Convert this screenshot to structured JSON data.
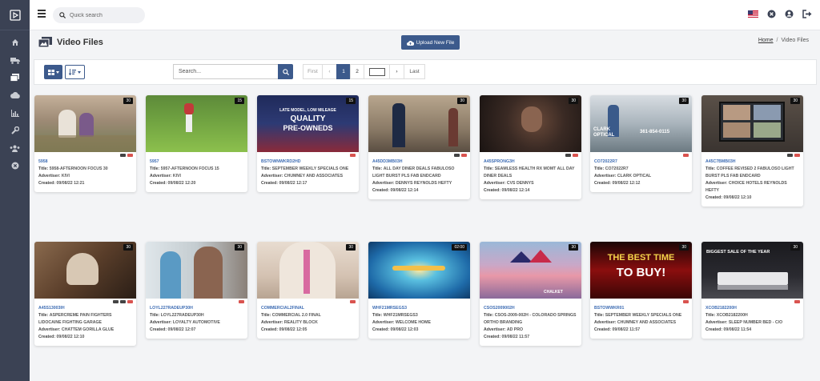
{
  "topbar": {
    "search_placeholder": "Quick search"
  },
  "header": {
    "title": "Video Files",
    "upload_label": "Upload New File",
    "breadcrumb_home": "Home",
    "breadcrumb_sep": "/",
    "breadcrumb_current": "Video Files"
  },
  "toolbar": {
    "search_placeholder": "Search...",
    "pager": {
      "first": "First",
      "prev": "‹",
      "page1": "1",
      "page2": "2",
      "next": "›",
      "last": "Last"
    }
  },
  "labels": {
    "title": "Title:",
    "advertiser": "Advertiser:",
    "created": "Created:"
  },
  "cards": [
    {
      "code": "5958",
      "title": "5958-AFTERNOON FOCUS 30",
      "advertiser": "KIVI",
      "created": "09/08/22 12:21",
      "duration": "30"
    },
    {
      "code": "5957",
      "title": "5957-AFTERNOON FOCUS 15",
      "advertiser": "KIVI",
      "created": "09/08/22 12:20",
      "duration": "15"
    },
    {
      "code": "BSTOWNWKRD2HD",
      "title": "SEPTEMBER WEEKLY SPECIALS ONE",
      "advertiser": "CHUMNEY AND ASSOCIATES",
      "created": "09/08/22 12:17",
      "duration": "15"
    },
    {
      "code": "A45DD3MB03H",
      "title": "ALL DAY DINER DEALS FABULOSO LIGHT BURST PLS FAB ENDCARD",
      "advertiser": "DENNYS REYNOLDS HEFTY",
      "created": "09/08/22 12:14",
      "duration": "30"
    },
    {
      "code": "A45SPRONG3H",
      "title": "SEAMLESS HEALTH RX MOMT ALL DAY DINER DEALS",
      "advertiser": "CVS DENNYS",
      "created": "09/08/22 12:14",
      "duration": "30"
    },
    {
      "code": "CO72022R7",
      "title": "CO72022R7",
      "advertiser": "CLARK OPTICAL",
      "created": "09/08/22 12:12",
      "duration": "30"
    },
    {
      "code": "A45C7BMB03H",
      "title": "COFFEE REVISED 2 FABULOSO LIGHT BURST PLS FAB ENDCARD",
      "advertiser": "CHOICE HOTELS REYNOLDS HEFTY",
      "created": "09/08/22 12:10",
      "duration": "30"
    },
    {
      "code": "A45S13003IH",
      "title": "ASPERCREME PAIN FIGHTERS LIDOCAINE FIGHTING GARAGE",
      "advertiser": "CHATTEM GORILLA GLUE",
      "created": "09/08/22 12:10",
      "duration": "30"
    },
    {
      "code": "LOYL227RADEUP30H",
      "title": "LOYL227RADEUP30H",
      "advertiser": "LOYALTY AUTOMOTIVE",
      "created": "09/08/22 12:07",
      "duration": "30"
    },
    {
      "code": "COMMERCIAL2FINAL",
      "title": "COMMERCIAL 2.0 FINAL",
      "advertiser": "REALITY BLOCK",
      "created": "09/08/22 12:05",
      "duration": "30"
    },
    {
      "code": "WHF21MRSEGS3",
      "title": "WHF21MRSEGS3",
      "advertiser": "WELCOME HOME",
      "created": "09/08/22 12:03",
      "duration": "02:00"
    },
    {
      "code": "CSOS2009002H",
      "title": "CSOS-2009-002H - COLORADO SPRINGS ORTHO BRANDING",
      "advertiser": "AD PRO",
      "created": "09/08/22 11:57",
      "duration": "30"
    },
    {
      "code": "BSTOWWKR01",
      "title": "SEPTEMBER WEEKLY SPECIALS ONE",
      "advertiser": "CHUMNEY AND ASSOCIATES",
      "created": "09/08/22 11:57",
      "duration": "30"
    },
    {
      "code": "XCOB2182200H",
      "title": "XCOB2182200H",
      "advertiser": "SLEEP NUMBER BED - C/O",
      "created": "09/08/22 11:54",
      "duration": "30"
    }
  ],
  "thumb_text": {
    "t3a": "LATE MODEL, LOW MILEAGE",
    "t3b": "QUALITY",
    "t3c": "PRE-OWNEDS",
    "t6a": "CLARK",
    "t6b": "OPTICAL",
    "t6c": "361-854-0115",
    "t12": "CHALKET",
    "t13a": "THE BEST TIME",
    "t13b": "TO BUY!",
    "t14": "BIGGEST SALE OF THE YEAR"
  },
  "colors": {
    "sidebar": "#3b4254",
    "primary": "#3c5a8c",
    "link": "#3d6cb3"
  },
  "icons": [
    "logo-icon",
    "home-icon",
    "truck-icon",
    "video-files-icon",
    "cloud-icon",
    "chart-icon",
    "wrench-icon",
    "users-icon",
    "close-circle-icon",
    "flag-us-icon",
    "user-circle-icon",
    "logout-icon",
    "search-icon",
    "grid-view-icon",
    "list-view-icon"
  ]
}
